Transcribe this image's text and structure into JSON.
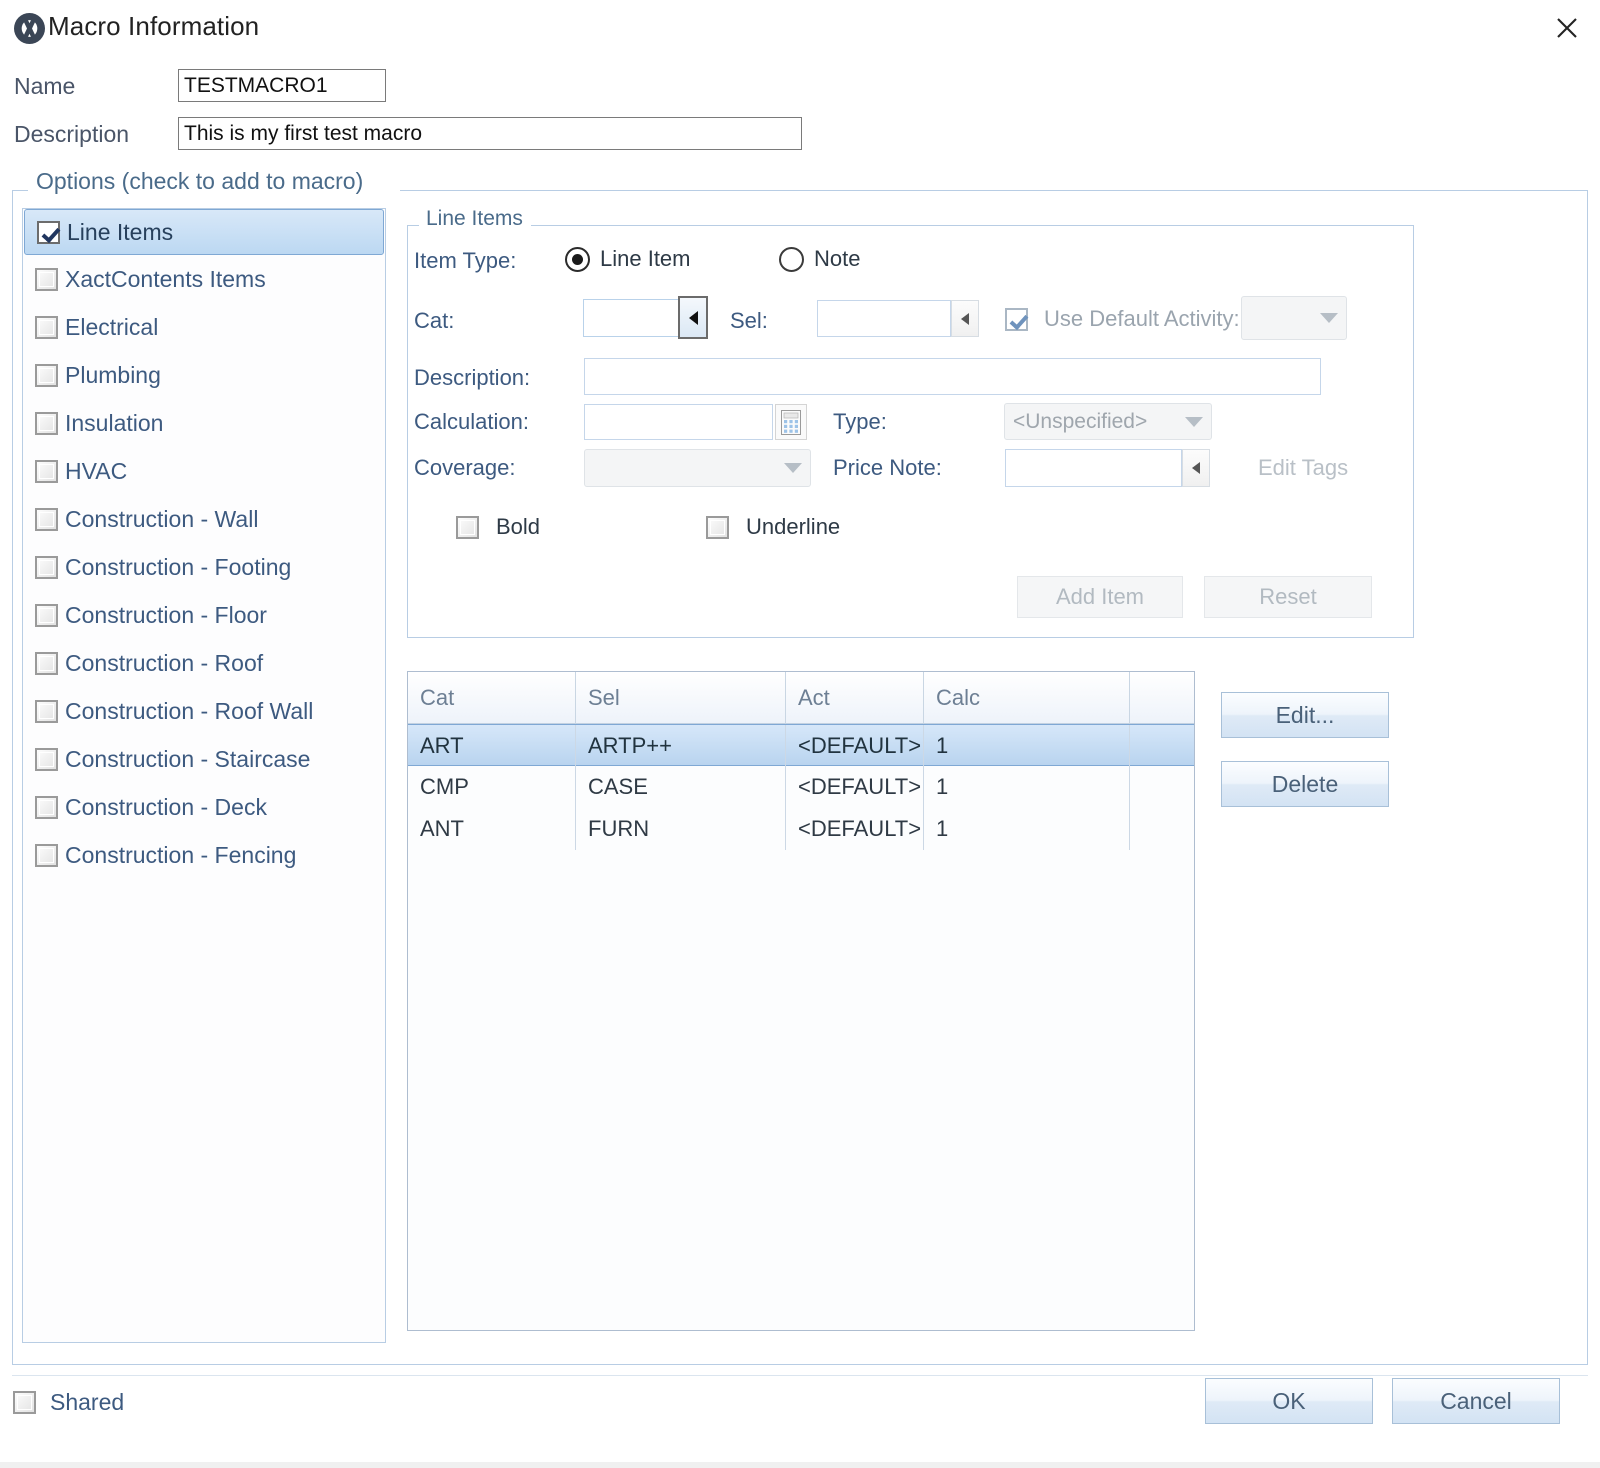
{
  "window": {
    "title": "Macro Information",
    "app_icon": "xactimate-x-icon",
    "close_icon": "close-icon"
  },
  "form": {
    "name_label": "Name",
    "name_value": "TESTMACRO1",
    "name_placeholder": "",
    "description_label": "Description",
    "description_value": "This is my first test macro",
    "description_placeholder": ""
  },
  "options_group": {
    "legend": "Options (check to add to macro)",
    "items": [
      {
        "label": "Line Items",
        "checked": true,
        "selected": true
      },
      {
        "label": "XactContents Items",
        "checked": false,
        "selected": false
      },
      {
        "label": "Electrical",
        "checked": false,
        "selected": false
      },
      {
        "label": "Plumbing",
        "checked": false,
        "selected": false
      },
      {
        "label": "Insulation",
        "checked": false,
        "selected": false
      },
      {
        "label": "HVAC",
        "checked": false,
        "selected": false
      },
      {
        "label": "Construction - Wall",
        "checked": false,
        "selected": false
      },
      {
        "label": "Construction - Footing",
        "checked": false,
        "selected": false
      },
      {
        "label": "Construction - Floor",
        "checked": false,
        "selected": false
      },
      {
        "label": "Construction - Roof",
        "checked": false,
        "selected": false
      },
      {
        "label": "Construction - Roof Wall",
        "checked": false,
        "selected": false
      },
      {
        "label": "Construction - Staircase",
        "checked": false,
        "selected": false
      },
      {
        "label": "Construction - Deck",
        "checked": false,
        "selected": false
      },
      {
        "label": "Construction - Fencing",
        "checked": false,
        "selected": false
      }
    ]
  },
  "line_items_panel": {
    "legend": "Line Items",
    "item_type_label": "Item Type:",
    "radio_line_item": "Line Item",
    "radio_note": "Note",
    "radio_selected": "Line Item",
    "cat_label": "Cat:",
    "cat_value": "",
    "sel_label": "Sel:",
    "sel_value": "",
    "use_default_activity_label": "Use Default Activity:",
    "use_default_activity_checked": true,
    "activity_value": "",
    "description_label": "Description:",
    "description_value": "",
    "calculation_label": "Calculation:",
    "calculation_value": "",
    "calculator_icon": "calculator-icon",
    "type_label": "Type:",
    "type_value": "<Unspecified>",
    "coverage_label": "Coverage:",
    "coverage_value": "",
    "price_note_label": "Price Note:",
    "price_note_value": "",
    "edit_tags_label": "Edit Tags",
    "bold_label": "Bold",
    "bold_checked": false,
    "underline_label": "Underline",
    "underline_checked": false,
    "add_item_label": "Add Item",
    "reset_label": "Reset"
  },
  "grid": {
    "columns": [
      "Cat",
      "Sel",
      "Act",
      "Calc",
      ""
    ],
    "rows": [
      {
        "cat": "ART",
        "sel": "ARTP++",
        "act": "<DEFAULT>",
        "calc": "1",
        "extra": "",
        "selected": true
      },
      {
        "cat": "CMP",
        "sel": "CASE",
        "act": "<DEFAULT>",
        "calc": "1",
        "extra": "",
        "selected": false
      },
      {
        "cat": "ANT",
        "sel": "FURN",
        "act": "<DEFAULT>",
        "calc": "1",
        "extra": "",
        "selected": false
      }
    ],
    "edit_button": "Edit...",
    "delete_button": "Delete"
  },
  "footer": {
    "shared_label": "Shared",
    "shared_checked": false,
    "ok_label": "OK",
    "cancel_label": "Cancel"
  },
  "colors": {
    "accent_border": "#b8cde4",
    "label_blue": "#3d5a80",
    "selection_blue": "#bcd8f2",
    "disabled_text": "#b2bac1"
  }
}
